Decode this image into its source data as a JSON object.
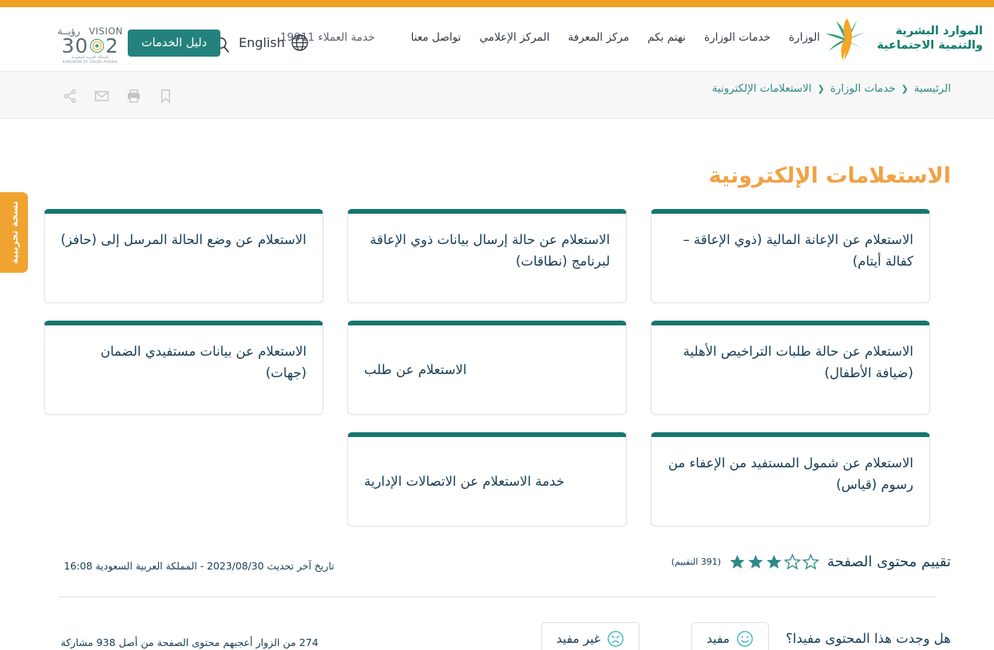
{
  "header": {
    "logo_line1": "الموارد البشرية",
    "logo_line2": "والتنمية الاجتماعية",
    "nav_items": [
      {
        "label": "الوزارة"
      },
      {
        "label": "خدمات الوزارة"
      },
      {
        "label": "نهتم بكم"
      },
      {
        "label": "مركز المعرفة"
      },
      {
        "label": "المركز الإعلامي"
      },
      {
        "label": "تواصل معنا"
      }
    ],
    "customer_care": "خدمة العملاء 19911",
    "language_label": "English",
    "services_guide_label": "دليل الخدمات",
    "vision_word": "VISION",
    "vision_arabic": "رؤيــة",
    "vision_number_left": "2",
    "vision_number_right": "30",
    "vision_subtitle": "المملكة العربية السعودية",
    "vision_subtitle_en": "KINGDOM OF SAUDI ARABIA"
  },
  "breadcrumb": {
    "items": [
      {
        "label": "الرئيسية"
      },
      {
        "label": "خدمات الوزارة"
      },
      {
        "label": "الاستعلامات الإلكترونية"
      }
    ],
    "separator": "❮"
  },
  "share_icons": [
    {
      "name": "share-icon"
    },
    {
      "name": "email-icon"
    },
    {
      "name": "print-icon"
    },
    {
      "name": "bookmark-icon"
    }
  ],
  "beta_tab": {
    "label": "نسخة تجريبية"
  },
  "main": {
    "page_title": "الاستعلامات الإلكترونية",
    "cards": [
      {
        "label": "الاستعلام عن الإعانة المالية (ذوي الإعاقة – كفالة أيتام)"
      },
      {
        "label": "الاستعلام عن حالة إرسال بيانات ذوي الإعاقة لبرنامج (نطاقات)"
      },
      {
        "label": "الاستعلام عن وضع الحالة المرسل إلى (حافز)"
      },
      {
        "label": "الاستعلام عن حالة طلبات التراخيص الأهلية (ضيافة الأطفال)"
      },
      {
        "label": "الاستعلام عن طلب"
      },
      {
        "label": "الاستعلام عن بيانات مستفيدي الضمان (جهات)"
      },
      {
        "label": "الاستعلام عن شمول المستفيد من الإعفاء من رسوم (قياس)"
      },
      {
        "label": "خدمة الاستعلام عن الاتصالات الإدارية"
      }
    ]
  },
  "rating": {
    "label": "تقييم محتوى الصفحة",
    "filled_stars": 3,
    "total_stars": 5,
    "count_text": "(391 التقييم)",
    "last_update": "تاريخ آخر تحديث 2023/08/30  -  المملكة العربية السعودية 16:08"
  },
  "feedback": {
    "question": "هل وجدت هذا المحتوى مفيدا؟",
    "useful_label": "مفيد",
    "not_useful_label": "غير مفيد",
    "visitor_stats": "274 من الزوار أعجبهم محتوى الصفحة من أصل 938 مشاركة"
  },
  "colors": {
    "orange_strip": "#f0a020",
    "teal": "#24827c",
    "card_top_border": "#18766e",
    "title_orange": "#f0a246",
    "crumb_teal": "#2f8a86",
    "beta_orange": "#f0a330"
  }
}
